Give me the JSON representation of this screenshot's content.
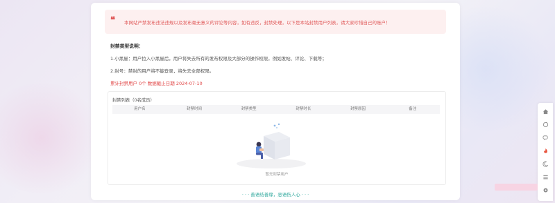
{
  "notice": {
    "quote_glyph": "❝",
    "text": "本网站严禁发布违法违规以及发布毫无意义的评论等内容，如有违反，封禁处理，以下是本站封禁用户列表，请大家珍惜自己的账户！"
  },
  "ban_types": {
    "title": "封禁类型说明：",
    "line1": "1.小黑屋：用户拉入小黑屋后，用户将失去所有的发布权限及大部分的操作权限，例如发帖、评论、下载等；",
    "line2": "2.封号：禁封的用户将不能登录，将失去全部权限。"
  },
  "stats": "累计封禁用户 0个 数据截止日期 2024-07-10",
  "ban_list": {
    "title": "封禁列表（0名成员）",
    "columns": [
      "用户名",
      "封禁时间",
      "封禁类型",
      "封禁时长",
      "封禁原因",
      "备注"
    ],
    "empty_text": "暂无封禁用户"
  },
  "footer": "· · · 善语结善缘，恶语伤人心 · · ·",
  "sidebar": {
    "icons": [
      "home-icon",
      "refresh-icon",
      "comment-icon",
      "fire-icon",
      "moon-icon",
      "grid-icon",
      "gear-icon"
    ]
  },
  "colors": {
    "accent_red": "#e05a5a",
    "footer_teal": "#2fa89d"
  }
}
